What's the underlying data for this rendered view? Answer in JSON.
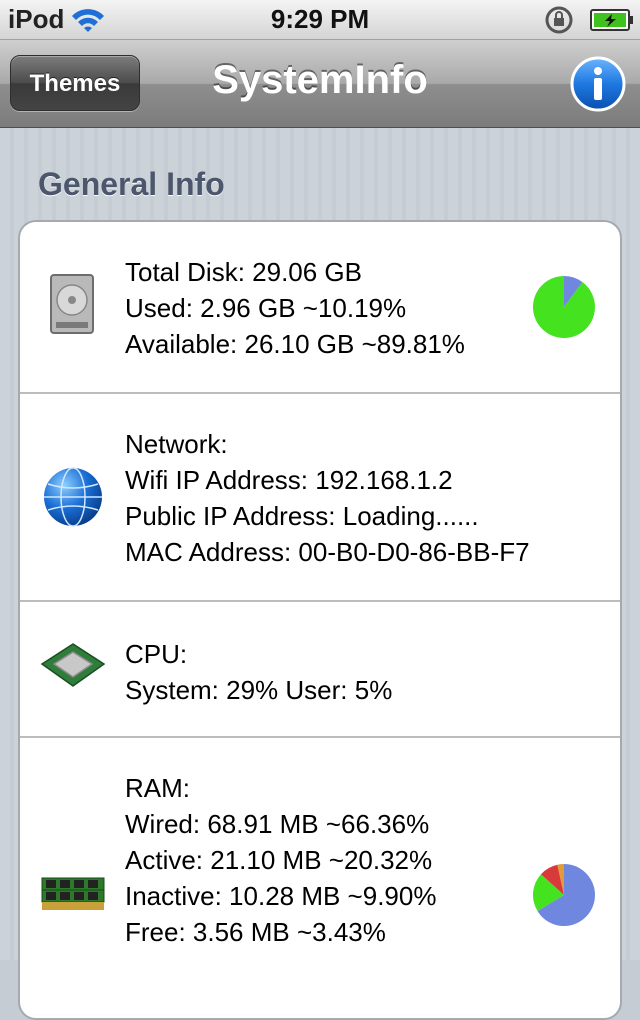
{
  "status_bar": {
    "carrier": "iPod",
    "time": "9:29 PM"
  },
  "nav": {
    "left_button": "Themes",
    "title": "SystemInfo",
    "right_icon": "info-icon"
  },
  "section": {
    "title": "General Info"
  },
  "colors": {
    "pie_green": "#44e21f",
    "pie_blue": "#6f87de",
    "pie_red": "#d83a3a",
    "pie_orange": "#e59a3a"
  },
  "cells": {
    "disk": {
      "icon": "hard-drive-icon",
      "lines": [
        "Total Disk: 29.06 GB",
        "Used: 2.96 GB ~10.19%",
        "Available: 26.10 GB ~89.81%"
      ],
      "pie": [
        {
          "label": "Used",
          "percent": 10.19
        },
        {
          "label": "Available",
          "percent": 89.81
        }
      ]
    },
    "network": {
      "icon": "globe-icon",
      "lines": [
        "Network:",
        "Wifi IP Address: 192.168.1.2",
        "Public IP Address: Loading......",
        "MAC Address: 00-B0-D0-86-BB-F7"
      ]
    },
    "cpu": {
      "icon": "cpu-chip-icon",
      "lines": [
        "CPU:",
        "System: 29% User: 5%"
      ]
    },
    "ram": {
      "icon": "ram-module-icon",
      "lines": [
        "RAM:",
        "Wired: 68.91 MB ~66.36%",
        "Active: 21.10 MB ~20.32%",
        "Inactive: 10.28 MB ~9.90%",
        "Free: 3.56 MB ~3.43%"
      ],
      "pie": [
        {
          "label": "Wired",
          "percent": 66.36
        },
        {
          "label": "Active",
          "percent": 20.32
        },
        {
          "label": "Inactive",
          "percent": 9.9
        },
        {
          "label": "Free",
          "percent": 3.43
        }
      ]
    }
  }
}
